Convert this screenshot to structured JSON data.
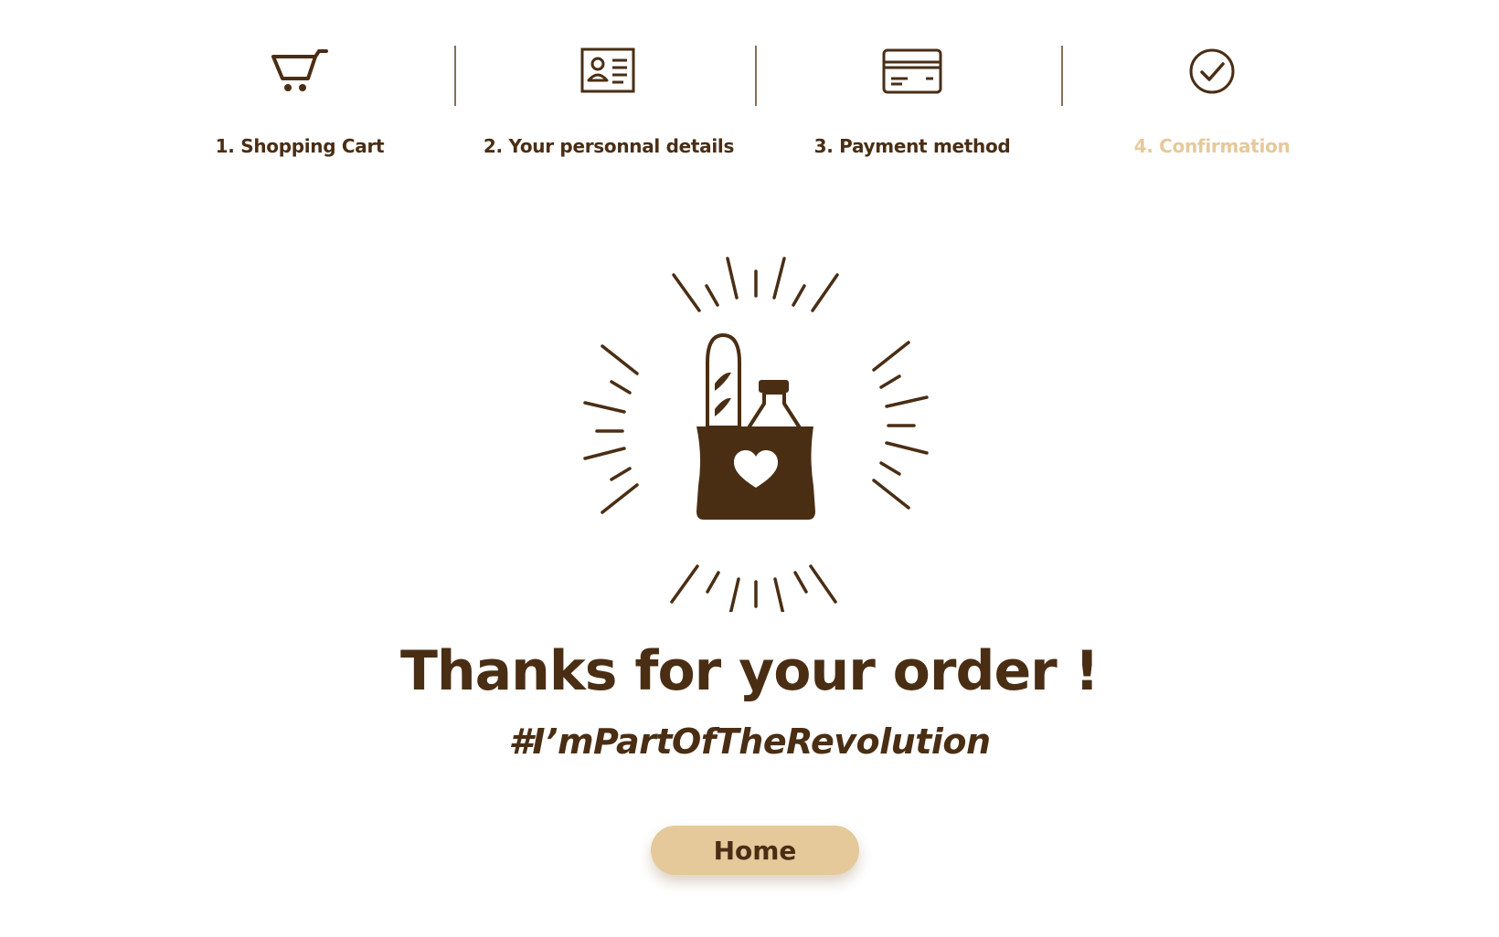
{
  "steps": [
    {
      "label": "1. Shopping Cart",
      "icon": "shopping-cart-icon"
    },
    {
      "label": "2. Your personnal details",
      "icon": "id-card-icon"
    },
    {
      "label": "3. Payment method",
      "icon": "credit-card-icon"
    },
    {
      "label": "4. Confirmation",
      "icon": "check-circle-icon",
      "active": true
    }
  ],
  "hero": {
    "icon": "grocery-bag-heart-icon"
  },
  "confirmation": {
    "title": "Thanks for your order !",
    "hashtag": "#I’mPartOfTheRevolution"
  },
  "actions": {
    "home_label": "Home"
  },
  "colors": {
    "primary": "#4a2e14",
    "accent": "#e6c99a",
    "background": "#ffffff"
  }
}
